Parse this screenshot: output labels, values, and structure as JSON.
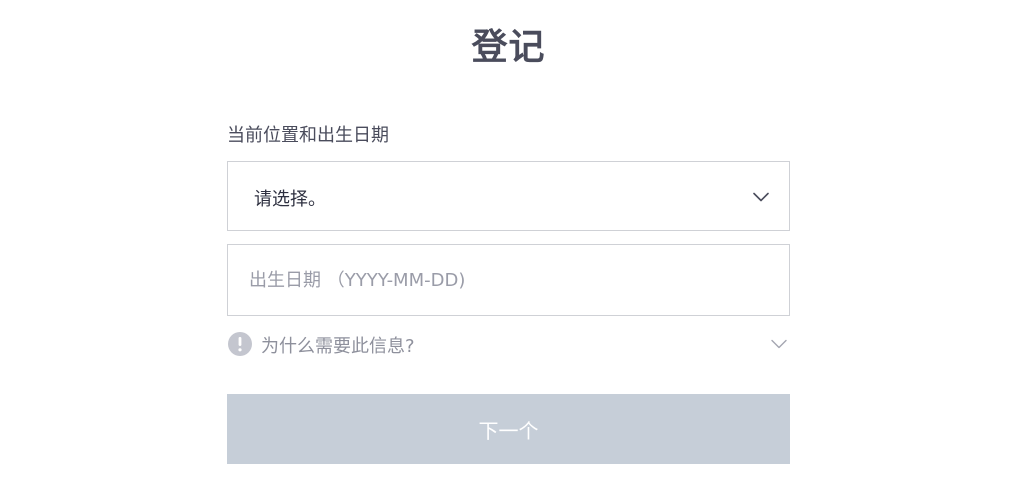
{
  "page": {
    "title": "登记"
  },
  "form": {
    "label": "当前位置和出生日期",
    "location_select": {
      "value": "请选择。"
    },
    "birthdate_input": {
      "value": "",
      "placeholder": "出生日期 （YYYY-MM-DD)"
    },
    "info_toggle": {
      "text": "为什么需要此信息?"
    },
    "next_button": {
      "label": "下一个",
      "enabled": false
    }
  },
  "icons": {
    "select_chevron": "chevron-down-icon",
    "info": "exclamation-circle-icon",
    "info_chevron": "chevron-down-icon"
  },
  "colors": {
    "title": "#4a4c5c",
    "border": "#cfd1d6",
    "placeholder": "#9a9ca8",
    "muted_text": "#8e909c",
    "info_icon": "#c4c6cf",
    "button_disabled_bg": "#c6ced8",
    "button_text": "#ffffff"
  }
}
